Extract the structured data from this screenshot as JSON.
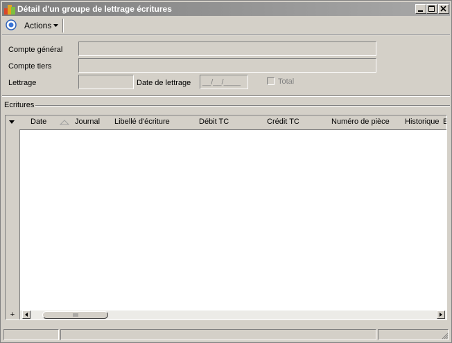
{
  "window": {
    "title": "Détail d'un groupe de lettrage écritures"
  },
  "toolbar": {
    "actions_label": "Actions"
  },
  "form": {
    "compte_general_label": "Compte général",
    "compte_general_value": "",
    "compte_tiers_label": "Compte tiers",
    "compte_tiers_value": "",
    "lettrage_label": "Lettrage",
    "lettrage_value": "",
    "date_lettrage_label": "Date de lettrage",
    "date_lettrage_value": "__/__/____",
    "total_label": "Total",
    "total_checked": false
  },
  "ecritures": {
    "section_label": "Ecritures",
    "columns": [
      "Date",
      "Journal",
      "Libellé d'écriture",
      "Débit TC",
      "Crédit TC",
      "Numéro de pièce",
      "Historique",
      "E"
    ],
    "rows": [],
    "add_button_label": "+"
  },
  "colors": {
    "window_bg": "#d4d0c8",
    "titlebar_gradient_start": "#7e7e7e",
    "titlebar_gradient_end": "#a8a8a8",
    "grid_bg": "#ffffff"
  }
}
